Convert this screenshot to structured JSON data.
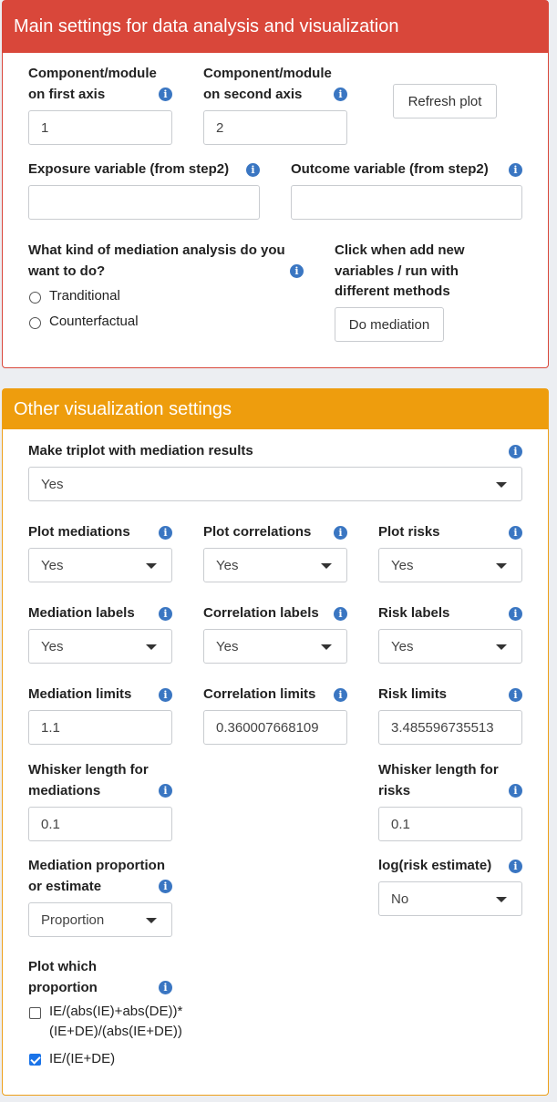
{
  "main": {
    "title": "Main settings for data analysis and visualization",
    "comp1_label": [
      "Component/module",
      "on first axis"
    ],
    "comp1_value": "1",
    "comp2_label": [
      "Component/module",
      "on second axis"
    ],
    "comp2_value": "2",
    "refresh_label": "Refresh plot",
    "exposure_label": "Exposure variable (from step2)",
    "exposure_value": "",
    "outcome_label": "Outcome variable (from step2)",
    "outcome_value": "",
    "mediation_kind_label": [
      "What kind of mediation analysis do you",
      "want to do?"
    ],
    "mediation_options": [
      "Tranditional",
      "Counterfactual"
    ],
    "add_vars_label": [
      "Click when add new",
      "variables / run with",
      "different methods"
    ],
    "do_mediation_label": "Do mediation"
  },
  "other": {
    "title": "Other visualization settings",
    "triplot_label": "Make triplot with mediation results",
    "triplot_value": "Yes",
    "plot_mediations_label": "Plot mediations",
    "plot_mediations_value": "Yes",
    "plot_correlations_label": "Plot correlations",
    "plot_correlations_value": "Yes",
    "plot_risks_label": "Plot risks",
    "plot_risks_value": "Yes",
    "mediation_labels_label": "Mediation labels",
    "mediation_labels_value": "Yes",
    "correlation_labels_label": "Correlation labels",
    "correlation_labels_value": "Yes",
    "risk_labels_label": "Risk labels",
    "risk_labels_value": "Yes",
    "mediation_limits_label": "Mediation limits",
    "mediation_limits_value": "1.1",
    "correlation_limits_label": "Correlation limits",
    "correlation_limits_value": "0.360007668109",
    "risk_limits_label": "Risk limits",
    "risk_limits_value": "3.485596735513",
    "whisker_med_label": [
      "Whisker length for",
      "mediations"
    ],
    "whisker_med_value": "0.1",
    "whisker_risk_label": [
      "Whisker length for",
      "risks"
    ],
    "whisker_risk_value": "0.1",
    "med_prop_label": [
      "Mediation proportion",
      "or estimate"
    ],
    "med_prop_value": "Proportion",
    "log_risk_label": "log(risk estimate)",
    "log_risk_value": "No",
    "plot_which_label": [
      "Plot which",
      "proportion"
    ],
    "proportion_options": [
      {
        "label": [
          "IE/(abs(IE)+abs(DE))*",
          "(IE+DE)/(abs(IE+DE))"
        ],
        "checked": false
      },
      {
        "label": [
          "IE/(IE+DE)"
        ],
        "checked": true
      }
    ]
  },
  "colors": {
    "main_header": "#d9473a",
    "other_header": "#ee9d0d",
    "info_icon": "#3a76c2",
    "checkbox": "#1a73e8"
  }
}
